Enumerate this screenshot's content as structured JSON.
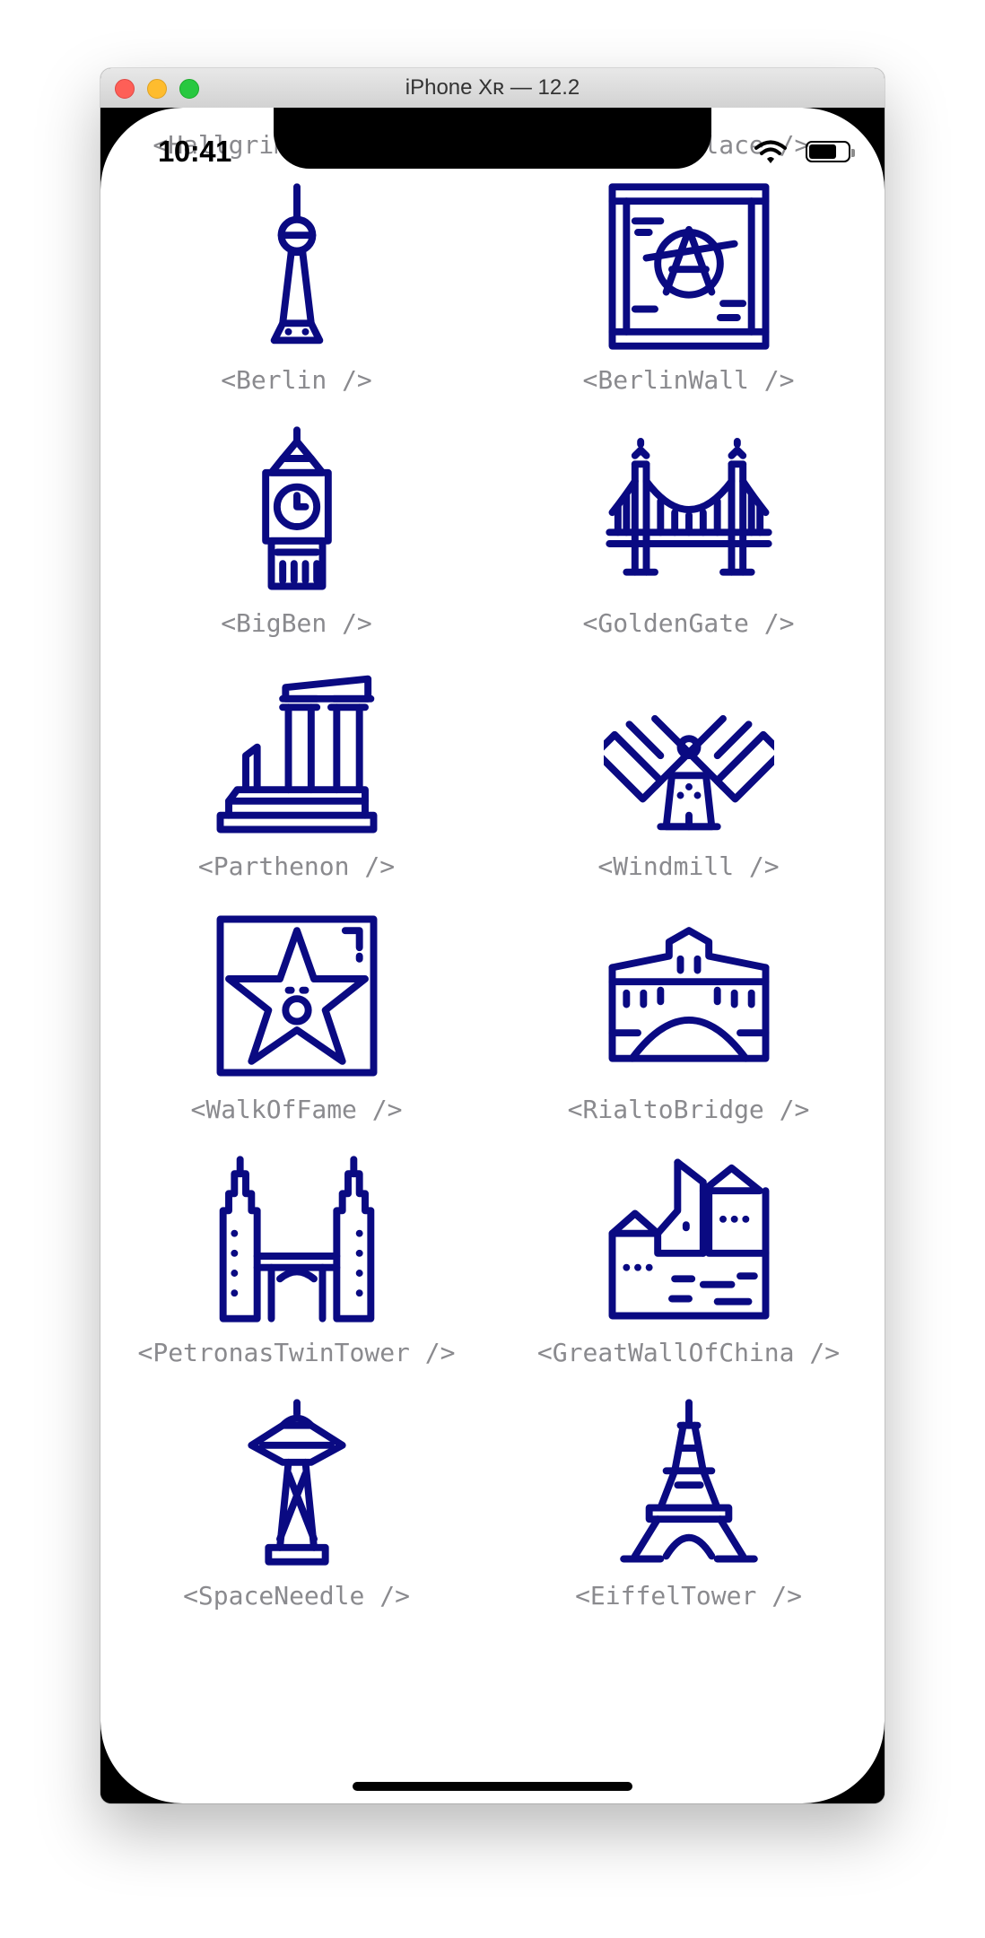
{
  "window": {
    "title": "iPhone Xʀ — 12.2"
  },
  "status_bar": {
    "time": "10:41"
  },
  "accent_color": "#0a0a82",
  "landmarks": [
    {
      "label": "<Hallgrimskirkja />",
      "icon": "hallgrimskirkja-icon"
    },
    {
      "label": "<HotelDeGlace />",
      "icon": "hotel-de-glace-icon"
    },
    {
      "label": "<Berlin />",
      "icon": "berlin-tv-tower-icon"
    },
    {
      "label": "<BerlinWall />",
      "icon": "berlin-wall-icon"
    },
    {
      "label": "<BigBen />",
      "icon": "big-ben-icon"
    },
    {
      "label": "<GoldenGate />",
      "icon": "golden-gate-icon"
    },
    {
      "label": "<Parthenon />",
      "icon": "parthenon-icon"
    },
    {
      "label": "<Windmill />",
      "icon": "windmill-icon"
    },
    {
      "label": "<WalkOfFame />",
      "icon": "walk-of-fame-icon"
    },
    {
      "label": "<RialtoBridge />",
      "icon": "rialto-bridge-icon"
    },
    {
      "label": "<PetronasTwinTower />",
      "icon": "petronas-twin-tower-icon"
    },
    {
      "label": "<GreatWallOfChina />",
      "icon": "great-wall-of-china-icon"
    },
    {
      "label": "<SpaceNeedle />",
      "icon": "space-needle-icon"
    },
    {
      "label": "<EiffelTower />",
      "icon": "eiffel-tower-icon"
    }
  ]
}
